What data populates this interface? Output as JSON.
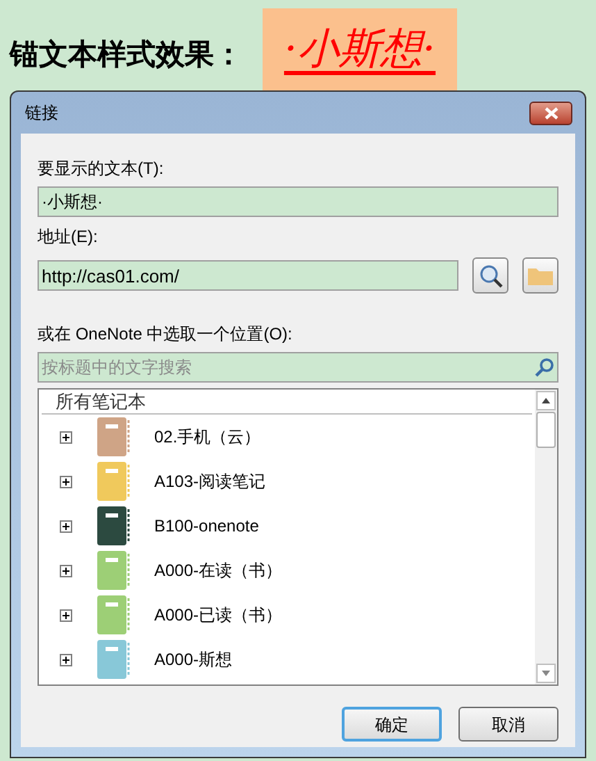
{
  "heading": "锚文本样式效果：",
  "styled_text": "·小斯想·",
  "dialog": {
    "title": "链接",
    "display_text": {
      "label": "要显示的文本(T):",
      "value": "·小斯想·"
    },
    "address": {
      "label": "地址(E):",
      "value": "http://cas01.com/"
    },
    "location": {
      "label": "或在 OneNote 中选取一个位置(O):",
      "search_placeholder": "按标题中的文字搜索"
    },
    "tree": {
      "root": "所有笔记本",
      "items": [
        {
          "label": "02.手机（云）",
          "color": "#cfa486",
          "expanded": false
        },
        {
          "label": "A103-阅读笔记",
          "color": "#f0c95c",
          "expanded": false
        },
        {
          "label": "B100-onenote",
          "color": "#2c4a40",
          "expanded": false
        },
        {
          "label": "A000-在读（书）",
          "color": "#9dcf76",
          "expanded": false
        },
        {
          "label": "A000-已读（书）",
          "color": "#9dcf76",
          "expanded": false
        },
        {
          "label": "A000-斯想",
          "color": "#88c8d8",
          "expanded": false
        }
      ]
    },
    "buttons": [
      "确定",
      "取消"
    ]
  }
}
